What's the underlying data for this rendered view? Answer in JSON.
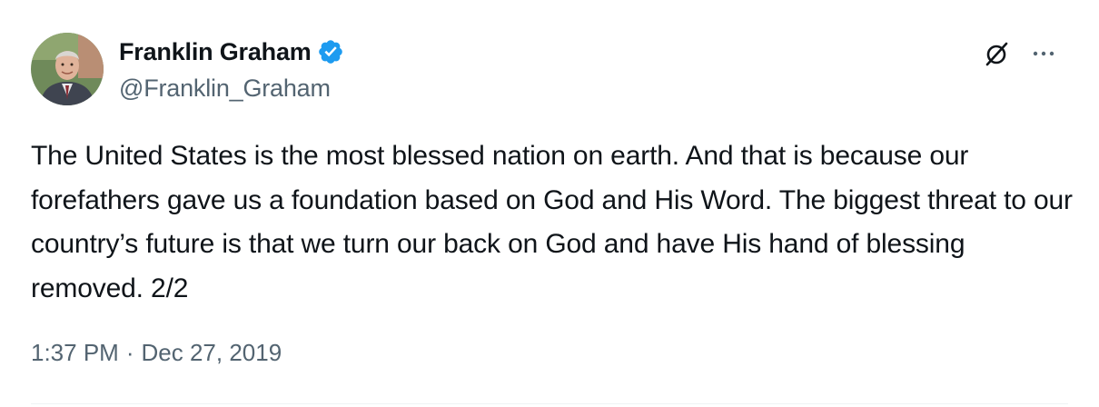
{
  "tweet": {
    "author": {
      "display_name": "Franklin Graham",
      "handle": "@Franklin_Graham",
      "verified": true
    },
    "text": "The United States is the most blessed nation on earth. And that is because our forefathers gave us a foundation based on God and His Word. The biggest threat to our country’s future is that we turn our back on God and have His hand of blessing removed. 2/2",
    "time": "1:37 PM",
    "separator": "·",
    "date": "Dec 27, 2019"
  },
  "icons": {
    "verified": "verified-badge-icon",
    "grok": "grok-icon",
    "more": "more-icon"
  },
  "colors": {
    "text": "#0f1419",
    "secondary": "#536471",
    "verified_blue": "#1d9bf0",
    "divider": "#eff3f4"
  }
}
